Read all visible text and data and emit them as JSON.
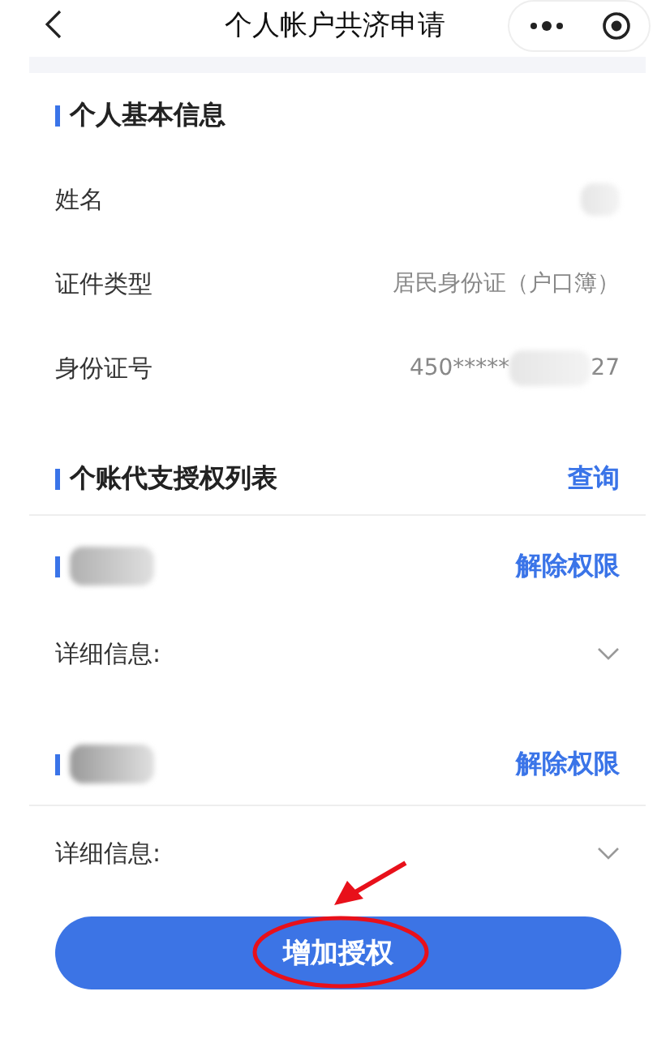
{
  "nav_bar": {
    "title": "个人帐户共济申请"
  },
  "basic_info": {
    "title": "个人基本信息",
    "rows": [
      {
        "label": "姓名",
        "value_parts": [],
        "redacted": true
      },
      {
        "label": "证件类型",
        "value_parts": [
          "居民身份证（户口簿）"
        ]
      },
      {
        "label": "身份证号",
        "value_parts": [
          "450*****",
          "27"
        ],
        "redacted": true
      }
    ]
  },
  "authorization_list": {
    "title": "个账代支授权列表",
    "query_link": "查询",
    "items": [
      {
        "revoke_link": "解除权限",
        "detail_label": "详细信息:",
        "expanded": false,
        "divider_below": false
      },
      {
        "revoke_link": "解除权限",
        "detail_label": "详细信息:",
        "expanded": false,
        "divider_below": true
      }
    ]
  },
  "primary_button": {
    "label": "增加授权",
    "annotated": true
  }
}
